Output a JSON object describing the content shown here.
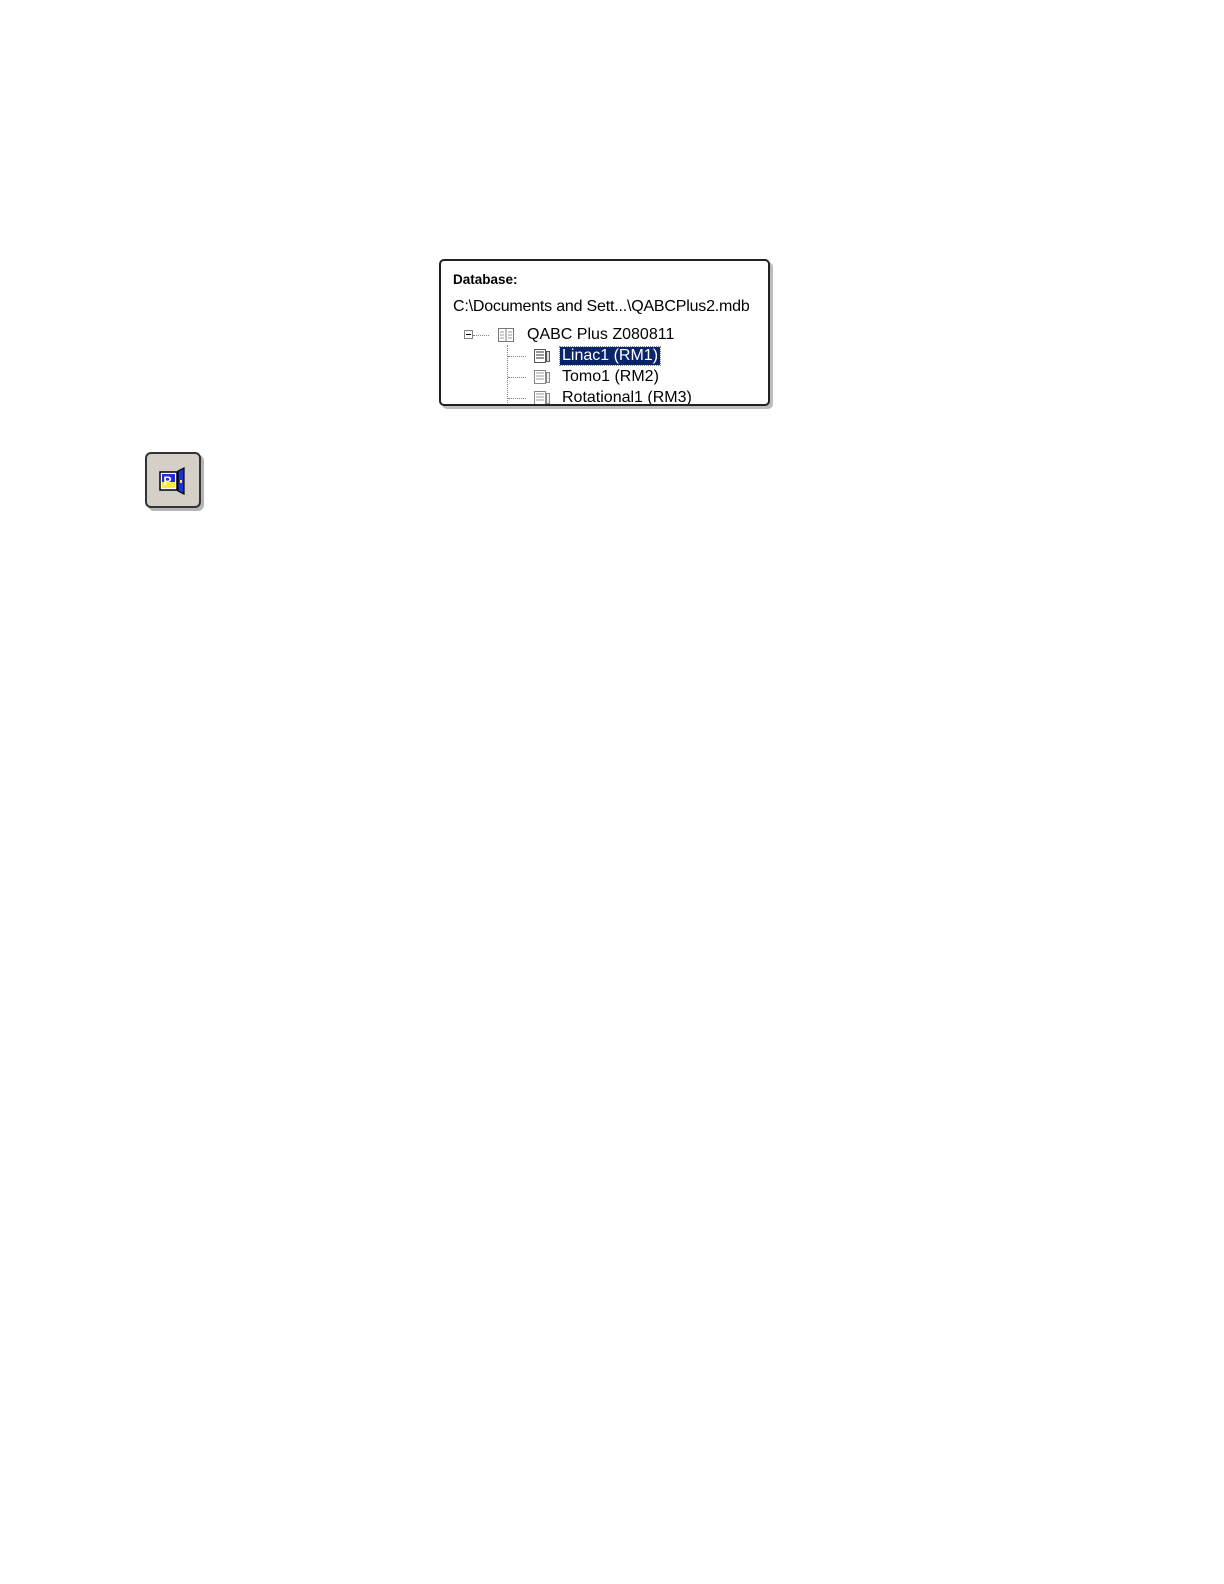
{
  "database_panel": {
    "label": "Database:",
    "path": "C:\\Documents and Sett...\\QABCPlus2.mdb",
    "tree": {
      "root": {
        "label": "QABC Plus Z080811",
        "icon": "database-book-icon",
        "expanded": true
      },
      "children": [
        {
          "label": "Linac1 (RM1)",
          "icon": "machine-book-icon",
          "selected": true
        },
        {
          "label": "Tomo1 (RM2)",
          "icon": "machine-book-icon",
          "selected": false
        },
        {
          "label": "Rotational1 (RM3)",
          "icon": "machine-book-icon",
          "selected": false
        }
      ]
    }
  },
  "toolbar_button": {
    "icon": "p-door-icon",
    "letter": "P"
  },
  "colors": {
    "selection_bg": "#0a246a",
    "selection_fg": "#ffffff",
    "icon_blue": "#1f2fd6",
    "icon_yellow": "#ffe84a"
  }
}
